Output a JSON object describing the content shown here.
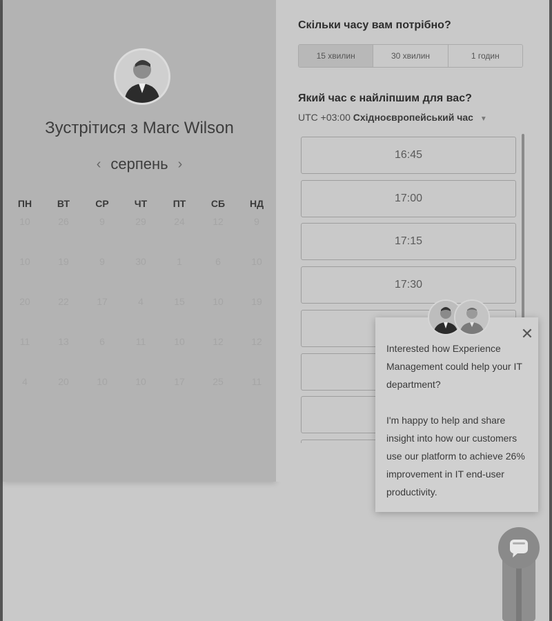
{
  "host": {
    "title": "Зустрітися з Marc Wilson"
  },
  "calendar": {
    "month": "серпень",
    "prev_label": "‹",
    "next_label": "›",
    "weekdays": [
      "ПН",
      "ВТ",
      "СР",
      "ЧТ",
      "ПТ",
      "СБ",
      "НД"
    ],
    "weeks": [
      [
        "10",
        "26",
        "9",
        "29",
        "24",
        "12",
        "9"
      ],
      [
        "10",
        "19",
        "9",
        "30",
        "1",
        "6",
        "10"
      ],
      [
        "20",
        "22",
        "17",
        "4",
        "15",
        "10",
        "19"
      ],
      [
        "11",
        "13",
        "6",
        "11",
        "10",
        "12",
        "12"
      ],
      [
        "4",
        "20",
        "10",
        "10",
        "17",
        "25",
        "11"
      ]
    ]
  },
  "booking": {
    "duration_question": "Скільки часу вам потрібно?",
    "durations": [
      "15 хвилин",
      "30 хвилин",
      "1 годин"
    ],
    "selected_duration": "15 хвилин",
    "time_question": "Який час є найліпшим для вас?",
    "timezone_offset": "UTC +03:00",
    "timezone_name": "Східноєвропейський час",
    "slots": [
      "16:45",
      "17:00",
      "17:15",
      "17:30",
      "",
      "",
      "",
      ""
    ]
  },
  "chat": {
    "message_1": "Interested how Experience Management could help your IT department?",
    "message_2": "I'm happy to help and share insight into how our customers use our platform to achieve 26% improvement in IT end-user productivity.",
    "close_label": "✕"
  },
  "colors": {
    "left_panel_bg": "#b3b3b3",
    "right_panel_bg": "#c9c9c9",
    "active_duration_bg": "#b8b8b8"
  }
}
